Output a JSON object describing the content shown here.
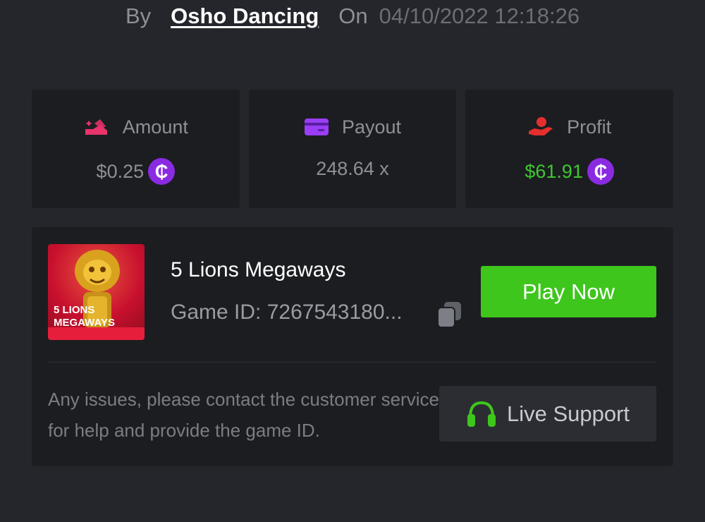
{
  "header": {
    "by_label": "By",
    "username": "Osho Dancing",
    "on_label": "On",
    "datetime": "04/10/2022 12:18:26"
  },
  "stats": [
    {
      "label": "Amount",
      "value": "$0.25",
      "icon": "amount-icon",
      "icon_color": "#e8336b",
      "has_coin": true
    },
    {
      "label": "Payout",
      "value": "248.64 x",
      "icon": "card-icon",
      "icon_color": "#9b3df5",
      "has_coin": false
    },
    {
      "label": "Profit",
      "value": "$61.91",
      "icon": "hand-profit-icon",
      "icon_color": "#e52f2f",
      "has_coin": true,
      "value_color": "#3fc630"
    }
  ],
  "coin_symbol": "₵",
  "game": {
    "title": "5 Lions Megaways",
    "thumb_text_line1": "5 LIONS",
    "thumb_text_line2": "MEGAWAYS",
    "id_label": "Game ID: 7267543180...",
    "play_label": "Play Now"
  },
  "support": {
    "help_text": "Any issues, please contact the customer service for help and provide the game ID.",
    "button_label": "Live Support"
  },
  "colors": {
    "background": "#25262b",
    "card": "#1c1d21",
    "accent_green": "#3ec61d",
    "coin_purple": "#8a2be2"
  }
}
